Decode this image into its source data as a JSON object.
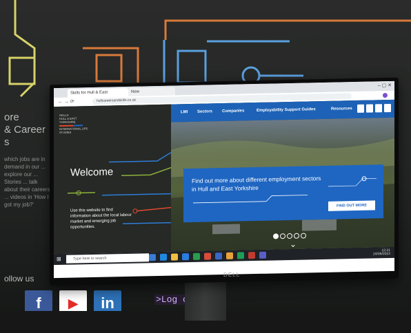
{
  "background": {
    "lines": [
      "ore",
      "& Career",
      "s"
    ],
    "paragraph": "which jobs are in demand in our ... explore our ... Stories ... talk about their careers ... videos in 'How I got my job?'",
    "follow": "ollow us",
    "social": [
      {
        "icon": "facebook-icon",
        "label": "f",
        "color": "#3b5998"
      },
      {
        "icon": "youtube-icon",
        "label": "▶",
        "color": "#e52d27"
      },
      {
        "icon": "linkedin-icon",
        "label": "in",
        "color": "#2d72b8"
      }
    ],
    "login_label": ">Log on ..."
  },
  "browser": {
    "tab_title": "Skills for Hull & East Yorkshire",
    "new_tab": "New",
    "url": "hullcareersandskills.co.uk"
  },
  "site": {
    "logo_lines": [
      "SKILLS",
      "HULL & EAST YORKSHIRE",
      "INTERNATIONAL LIFE STUDIES"
    ],
    "welcome": "Welcome",
    "intro": "Use this website to find information about the local labour market and emerging job opportunities.",
    "nav": [
      "LMI",
      "Sectors",
      "Companies",
      "Employability Support Guides",
      "Resources"
    ],
    "hero_text": "Find out more about different employment sectors in Hull and East Yorkshire",
    "hero_button": "FIND OUT MORE",
    "carousel_total": 5,
    "carousel_active": 0
  },
  "taskbar": {
    "search_placeholder": "Type here to search",
    "time": "12:21",
    "date": "24/06/2022"
  },
  "monitor": {
    "brand": "DELL"
  }
}
